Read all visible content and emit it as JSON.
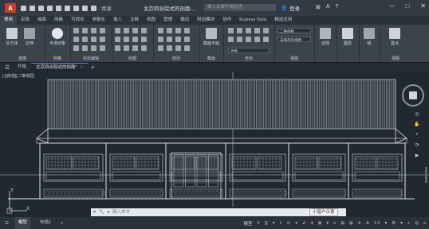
{
  "app": {
    "logo": "A",
    "share": "共享",
    "doc_title": "北京四合院式的剖面-...",
    "search_placeholder": "键入关键字或短语",
    "signin": "登录",
    "window_controls": [
      "─",
      "□",
      "✕"
    ]
  },
  "ribbon_tabs": [
    "常用",
    "实体",
    "曲面",
    "网格",
    "可视化",
    "参数化",
    "插入",
    "注释",
    "视图",
    "管理",
    "输出",
    "附加模块",
    "协作",
    "Express Tools",
    "精选应用"
  ],
  "ribbon": {
    "panels": [
      {
        "title": "建模",
        "buttons": [
          "长方体",
          "拉伸"
        ]
      },
      {
        "title": "网格",
        "buttons": [
          "平滑对象"
        ]
      },
      {
        "title": "实体编辑",
        "buttons": []
      },
      {
        "title": "绘图",
        "buttons": []
      },
      {
        "title": "修改",
        "buttons": []
      },
      {
        "title": "截面",
        "buttons": [
          "截面平面"
        ]
      },
      {
        "title": "坐标",
        "buttons": []
      },
      {
        "title": "视图",
        "buttons": []
      },
      {
        "title": "",
        "buttons": [
          "选择"
        ]
      },
      {
        "title": "",
        "buttons": [
          "图层"
        ]
      },
      {
        "title": "",
        "buttons": [
          "组"
        ]
      },
      {
        "title": "视图",
        "buttons": [
          "基点"
        ]
      }
    ],
    "dropdowns": [
      "二维线框",
      "未保存的视图",
      "世界"
    ]
  },
  "file_tabs": {
    "tabs": [
      "开始",
      "北京四合院式的剖面*"
    ],
    "close": "×",
    "add": "+"
  },
  "canvas": {
    "view_label": "[-][俯视][二维线框]",
    "ucs_y": "Y",
    "ucs_x": "X",
    "command_placeholder": "键入命令",
    "tooltip": "小窗户示意"
  },
  "statusbar": {
    "tabs": [
      "模型",
      "布局1"
    ],
    "add": "+",
    "right": [
      "模型",
      "#",
      "|||",
      "▾",
      "L",
      "⊙",
      "▾",
      "∠",
      "▾",
      "⊠",
      "▾",
      "≡",
      "⊞",
      "⊞",
      "✈",
      "A",
      "1:1",
      "▾",
      "⚙",
      "▾",
      "+",
      "⊡",
      "≡"
    ]
  }
}
